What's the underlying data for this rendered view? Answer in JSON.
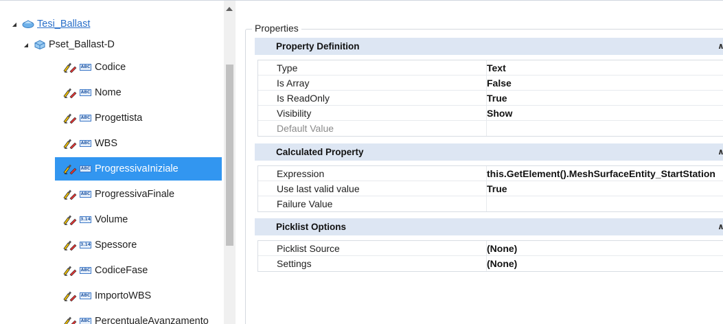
{
  "tree": {
    "root_label": "Tesi_Ballast",
    "pset_label": "Pset_Ballast-D",
    "items": [
      {
        "label": "Codice",
        "type": "ABC"
      },
      {
        "label": "Nome",
        "type": "ABC"
      },
      {
        "label": "Progettista",
        "type": "ABC"
      },
      {
        "label": "WBS",
        "type": "ABC"
      },
      {
        "label": "ProgressivaIniziale",
        "type": "ABC",
        "selected": true
      },
      {
        "label": "ProgressivaFinale",
        "type": "ABC"
      },
      {
        "label": "Volume",
        "type": "3.14"
      },
      {
        "label": "Spessore",
        "type": "3.14"
      },
      {
        "label": "CodiceFase",
        "type": "ABC"
      },
      {
        "label": "ImportoWBS",
        "type": "ABC"
      },
      {
        "label": "PercentualeAvanzamento",
        "type": "ABC"
      }
    ]
  },
  "properties": {
    "legend": "Properties",
    "sections": [
      {
        "title": "Property Definition",
        "rows": [
          {
            "name": "Type",
            "value": "Text"
          },
          {
            "name": "Is Array",
            "value": "False"
          },
          {
            "name": "Is ReadOnly",
            "value": "True"
          },
          {
            "name": "Visibility",
            "value": "Show"
          },
          {
            "name": "Default Value",
            "value": ""
          }
        ]
      },
      {
        "title": "Calculated Property",
        "rows": [
          {
            "name": "Expression",
            "value": "this.GetElement().MeshSurfaceEntity_StartStation"
          },
          {
            "name": "Use last valid value",
            "value": "True"
          },
          {
            "name": "Failure Value",
            "value": ""
          }
        ]
      },
      {
        "title": "Picklist Options",
        "rows": [
          {
            "name": "Picklist Source",
            "value": "(None)"
          },
          {
            "name": "Settings",
            "value": "(None)"
          }
        ]
      }
    ]
  },
  "colors": {
    "selection": "#3296f0",
    "section_header": "#dde6f3",
    "badge_border": "#3c78c8"
  },
  "icons": {
    "expand": "triangle-down-icon",
    "library": "library-icon",
    "propset": "cube-icon",
    "edit": "pencil-ruler-icon",
    "collapse": "chevron-up-icon"
  }
}
